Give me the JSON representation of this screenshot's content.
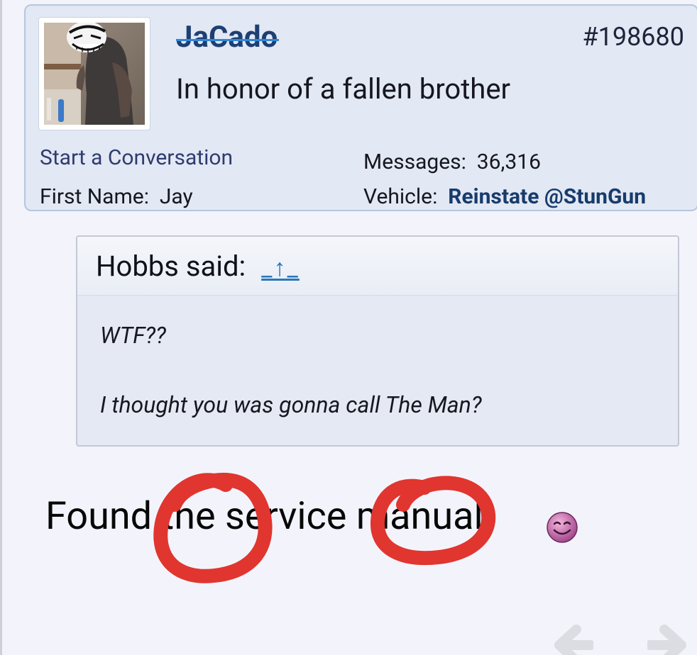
{
  "post": {
    "username": "JaCado",
    "post_number": "#198680",
    "user_title": "In honor of a fallen brother",
    "start_conversation": "Start a Conversation",
    "first_name_label": "First Name:",
    "first_name_value": "Jay",
    "messages_label": "Messages:",
    "messages_value": "36,316",
    "vehicle_label": "Vehicle:",
    "vehicle_value": "Reinstate @StunGun"
  },
  "quote": {
    "attribution": "Hobbs said:",
    "jump_glyph": "_↑_",
    "line1": "WTF??",
    "line2": "I thought you was gonna call The Man?"
  },
  "body": {
    "text": "Found the service manual."
  },
  "icons": {
    "avatar": "avatar-image",
    "smiley": "smiley-icon",
    "prev": "arrow-left-icon",
    "next": "arrow-right-icon"
  },
  "colors": {
    "card_background": "#e2e8f4",
    "card_border": "#b6c7dc",
    "username": "#1e3f72",
    "strike": "#2f88d9",
    "vehicle_value": "#173b6c",
    "link": "#2a76b9",
    "annotation": "#e1352f"
  }
}
